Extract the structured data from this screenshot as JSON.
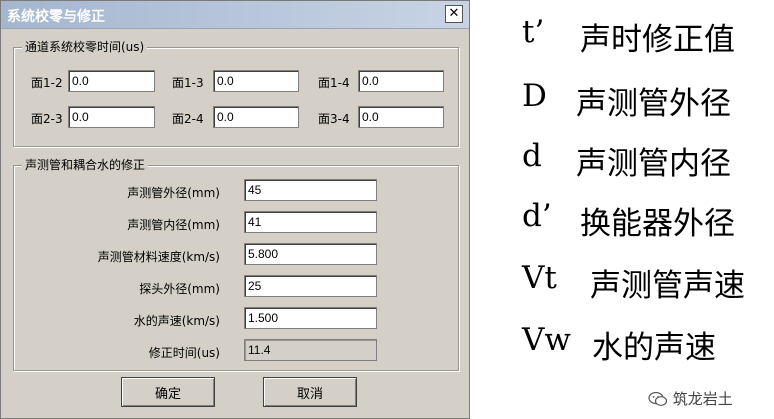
{
  "dialog": {
    "title": "系统校零与修正",
    "close_glyph": "✕",
    "channel_group": {
      "title": "通道系统校零时间(us)",
      "fields": [
        {
          "label": "面1-2",
          "value": "0.0"
        },
        {
          "label": "面1-3",
          "value": "0.0"
        },
        {
          "label": "面1-4",
          "value": "0.0"
        },
        {
          "label": "面2-3",
          "value": "0.0"
        },
        {
          "label": "面2-4",
          "value": "0.0"
        },
        {
          "label": "面3-4",
          "value": "0.0"
        }
      ]
    },
    "correction_group": {
      "title": "声测管和耦合水的修正",
      "fields": [
        {
          "label": "声测管外径(mm)",
          "value": "45"
        },
        {
          "label": "声测管内径(mm)",
          "value": "41"
        },
        {
          "label": "声测管材料速度(km/s)",
          "value": "5.800"
        },
        {
          "label": "探头外径(mm)",
          "value": "25"
        },
        {
          "label": "水的声速(km/s)",
          "value": "1.500"
        },
        {
          "label": "修正时间(us)",
          "value": "11.4"
        }
      ]
    },
    "ok_label": "确定",
    "cancel_label": "取消"
  },
  "legend": [
    {
      "symbol": "t’",
      "desc": "声时修正值"
    },
    {
      "symbol": "D",
      "desc": "声测管外径"
    },
    {
      "symbol": "d",
      "desc": "声测管内径"
    },
    {
      "symbol": "d’",
      "desc": "换能器外径"
    },
    {
      "symbol": "Vt",
      "desc": "声测管声速"
    },
    {
      "symbol": "Vw",
      "desc": "水的声速"
    }
  ],
  "watermark": {
    "text": "筑龙岩土",
    "icon": "wechat-icon"
  }
}
